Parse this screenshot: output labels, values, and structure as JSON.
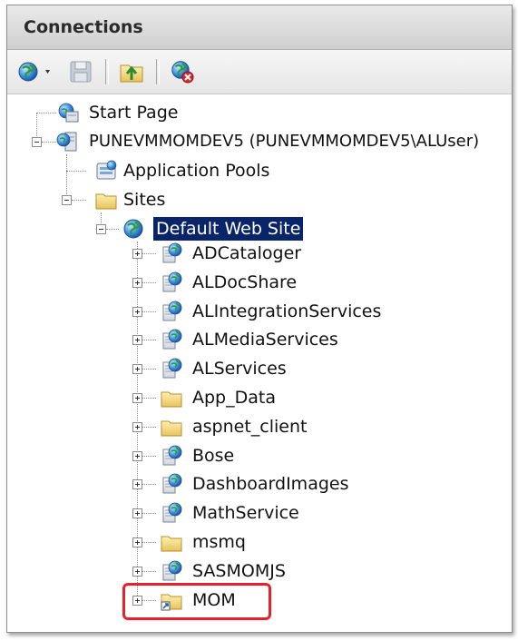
{
  "panel": {
    "title": "Connections"
  },
  "toolbar": {
    "buttons": [
      {
        "name": "create-connection",
        "icon": "globe-connect-icon"
      },
      {
        "name": "save-connections",
        "icon": "save-icon"
      },
      {
        "name": "up",
        "icon": "up-folder-icon"
      },
      {
        "name": "delete-connection",
        "icon": "disconnect-icon"
      }
    ]
  },
  "tree": {
    "start_page": "Start Page",
    "server": "PUNEVMMOMDEV5 (PUNEVMMOMDEV5\\ALUser)",
    "app_pools": "Application Pools",
    "sites": "Sites",
    "default_site": "Default Web Site",
    "children": [
      {
        "label": "ADCataloger",
        "type": "application"
      },
      {
        "label": "ALDocShare",
        "type": "application"
      },
      {
        "label": "ALIntegrationServices",
        "type": "application"
      },
      {
        "label": "ALMediaServices",
        "type": "application"
      },
      {
        "label": "ALServices",
        "type": "application"
      },
      {
        "label": "App_Data",
        "type": "folder"
      },
      {
        "label": "aspnet_client",
        "type": "folder"
      },
      {
        "label": "Bose",
        "type": "application"
      },
      {
        "label": "DashboardImages",
        "type": "application"
      },
      {
        "label": "MathService",
        "type": "application"
      },
      {
        "label": "msmq",
        "type": "folder"
      },
      {
        "label": "SASMOMJS",
        "type": "application"
      },
      {
        "label": "MOM",
        "type": "virtual-directory"
      }
    ]
  },
  "colors": {
    "selection": "#0a246a",
    "highlight": "#e8202a"
  }
}
